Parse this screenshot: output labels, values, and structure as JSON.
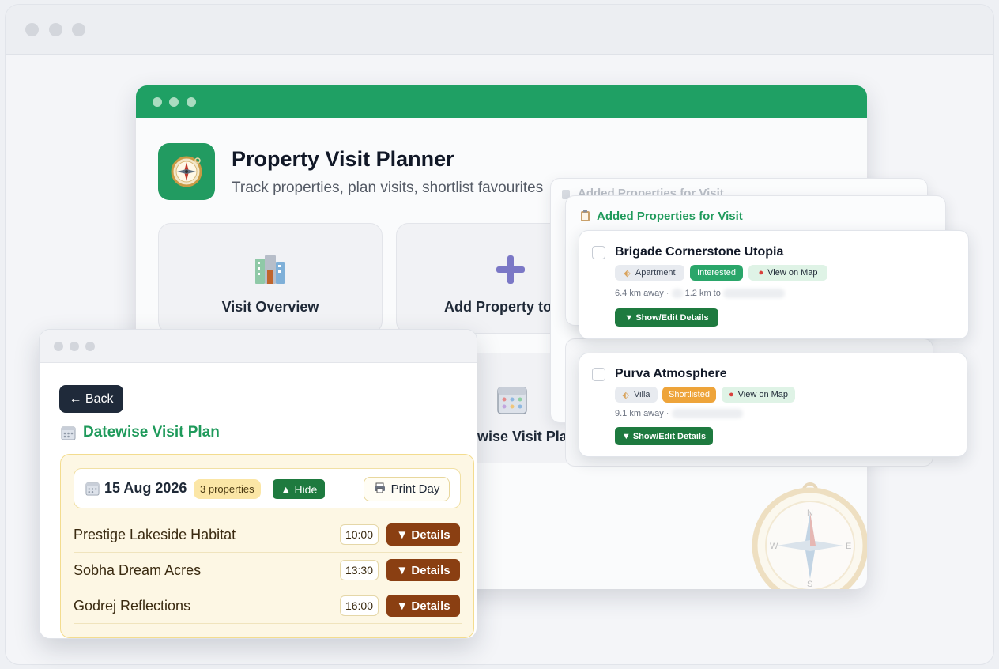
{
  "app": {
    "title": "Property Visit Planner",
    "subtitle": "Track properties, plan visits, shortlist favourites"
  },
  "cards": [
    {
      "label": "Visit Overview",
      "icon": "buildings-icon"
    },
    {
      "label": "Add Property to",
      "icon": "plus-icon"
    },
    {
      "label": "Datewise Visit Plan",
      "icon": "calendar-icon"
    }
  ],
  "properties_panel": {
    "title_back": "Added Properties for Visit",
    "title": "Added Properties for Visit",
    "items": [
      {
        "name": "Brigade Cornerstone Utopia",
        "type": "Apartment",
        "status": "Interested",
        "map_label": "View on Map",
        "distance": "6.4 km away ·",
        "distance2": "1.2 km to",
        "details_label": "▼ Show/Edit Details"
      },
      {
        "name": "Purva Atmosphere",
        "type": "Villa",
        "status": "Shortlisted",
        "map_label": "View on Map",
        "distance": "9.1 km away ·",
        "details_label": "▼ Show/Edit Details"
      }
    ]
  },
  "datewise": {
    "back_label": "← Back",
    "title": "Datewise Visit Plan",
    "day": {
      "date": "15 Aug 2026",
      "count": "3 properties",
      "hide_label": "▲ Hide",
      "print_label": "Print Day"
    },
    "visits": [
      {
        "name": "Prestige Lakeside Habitat",
        "time": "10:00",
        "details_label": "▼ Details"
      },
      {
        "name": "Sobha Dream Acres",
        "time": "13:30",
        "details_label": "▼ Details"
      },
      {
        "name": "Godrej Reflections",
        "time": "16:00",
        "details_label": "▼ Details"
      }
    ]
  },
  "colors": {
    "brand_green": "#1fa064",
    "dark_green": "#1e7a3f",
    "details_brown": "#8a3f12",
    "shortlisted": "#eea43a",
    "day_panel": "#fdf7e4"
  }
}
